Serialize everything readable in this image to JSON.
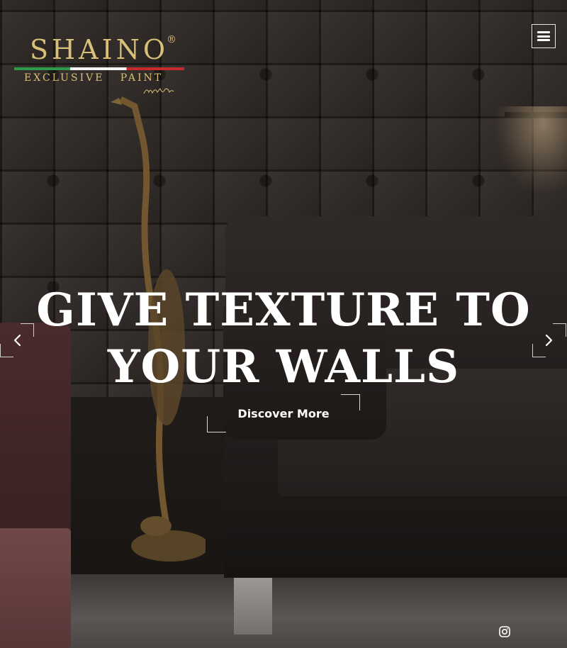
{
  "brand": {
    "name": "SHAINO",
    "registered_mark": "®",
    "tagline": "EXCLUSIVE   PAINT",
    "colors": {
      "gold": "#d9c079",
      "flag_green": "#2e9a4a",
      "flag_white": "#f3f3f3",
      "flag_red": "#c62b2b"
    }
  },
  "header": {
    "menu_icon": "hamburger-menu-icon"
  },
  "hero": {
    "headline_line1": "GIVE TEXTURE TO",
    "headline_line2": "YOUR WALLS",
    "cta_label": "Discover More",
    "prev_icon": "chevron-left-icon",
    "next_icon": "chevron-right-icon"
  },
  "social": {
    "instagram_icon": "instagram-icon"
  }
}
